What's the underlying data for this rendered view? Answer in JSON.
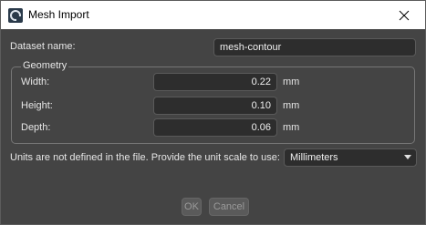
{
  "window": {
    "title": "Mesh Import"
  },
  "dataset": {
    "label": "Dataset name:",
    "value": "mesh-contour"
  },
  "geometry": {
    "title": "Geometry",
    "fields": [
      {
        "label": "Width:",
        "value": "0.22",
        "unit": "mm"
      },
      {
        "label": "Height:",
        "value": "0.10",
        "unit": "mm"
      },
      {
        "label": "Depth:",
        "value": "0.06",
        "unit": "mm"
      }
    ]
  },
  "units": {
    "prompt": "Units are not defined in the file. Provide the unit scale to use:",
    "selected": "Millimeters"
  },
  "buttons": {
    "ok": "OK",
    "cancel": "Cancel"
  },
  "icons": {
    "app": "app-icon",
    "close": "close-icon",
    "dropdown": "chevron-down-icon"
  }
}
